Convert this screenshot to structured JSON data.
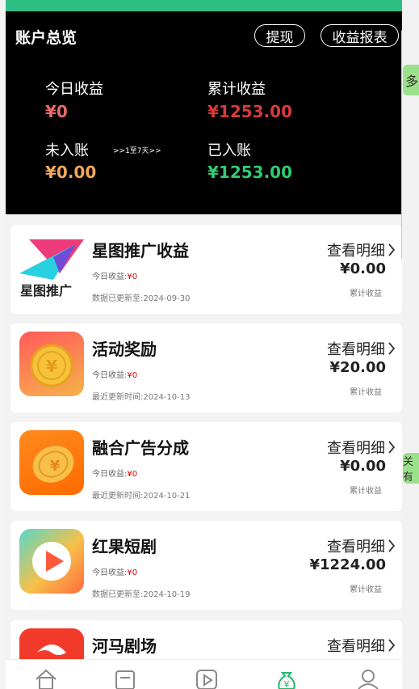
{
  "header": {
    "title": "账户总览",
    "withdraw_label": "提现",
    "report_label": "收益报表",
    "today_label": "今日收益",
    "today_value": "¥0",
    "cumulative_label": "累计收益",
    "cumulative_value": "¥1253.00",
    "pending_label": "未入账",
    "pending_note": ">>1至7天>>",
    "pending_value": "¥0.00",
    "settled_label": "已入账",
    "settled_value": "¥1253.00"
  },
  "cards": [
    {
      "title": "星图推广收益",
      "today_label": "今日收益:",
      "today_value": "¥0",
      "date": "数据已更新至:2024-09-30",
      "detail": "查看明细",
      "amount": "¥0.00",
      "total_label": "累计收益",
      "logo_text": "星图推广"
    },
    {
      "title": "活动奖励",
      "today_label": "今日收益:",
      "today_value": "¥0",
      "date": "最近更新时间:2024-10-13",
      "detail": "查看明细",
      "amount": "¥20.00",
      "total_label": "累计收益"
    },
    {
      "title": "融合广告分成",
      "today_label": "今日收益:",
      "today_value": "¥0",
      "date": "最近更新时间:2024-10-21",
      "detail": "查看明细",
      "amount": "¥0.00",
      "total_label": "累计收益"
    },
    {
      "title": "红果短剧",
      "today_label": "今日收益:",
      "today_value": "¥0",
      "date": "数据已更新至:2024-10-19",
      "detail": "查看明细",
      "amount": "¥1224.00",
      "total_label": "累计收益"
    },
    {
      "title": "河马剧场",
      "detail": "查看明细"
    }
  ],
  "nav": [
    "home-icon",
    "news-icon",
    "video-icon",
    "money-bag-icon",
    "profile-icon"
  ],
  "colors": {
    "accent_green": "#2fbf85",
    "red": "#e23b3b",
    "orange": "#f6a35b",
    "green_value": "#2ecc71"
  },
  "side_fragments": {
    "top": "多",
    "middle": "关有"
  }
}
